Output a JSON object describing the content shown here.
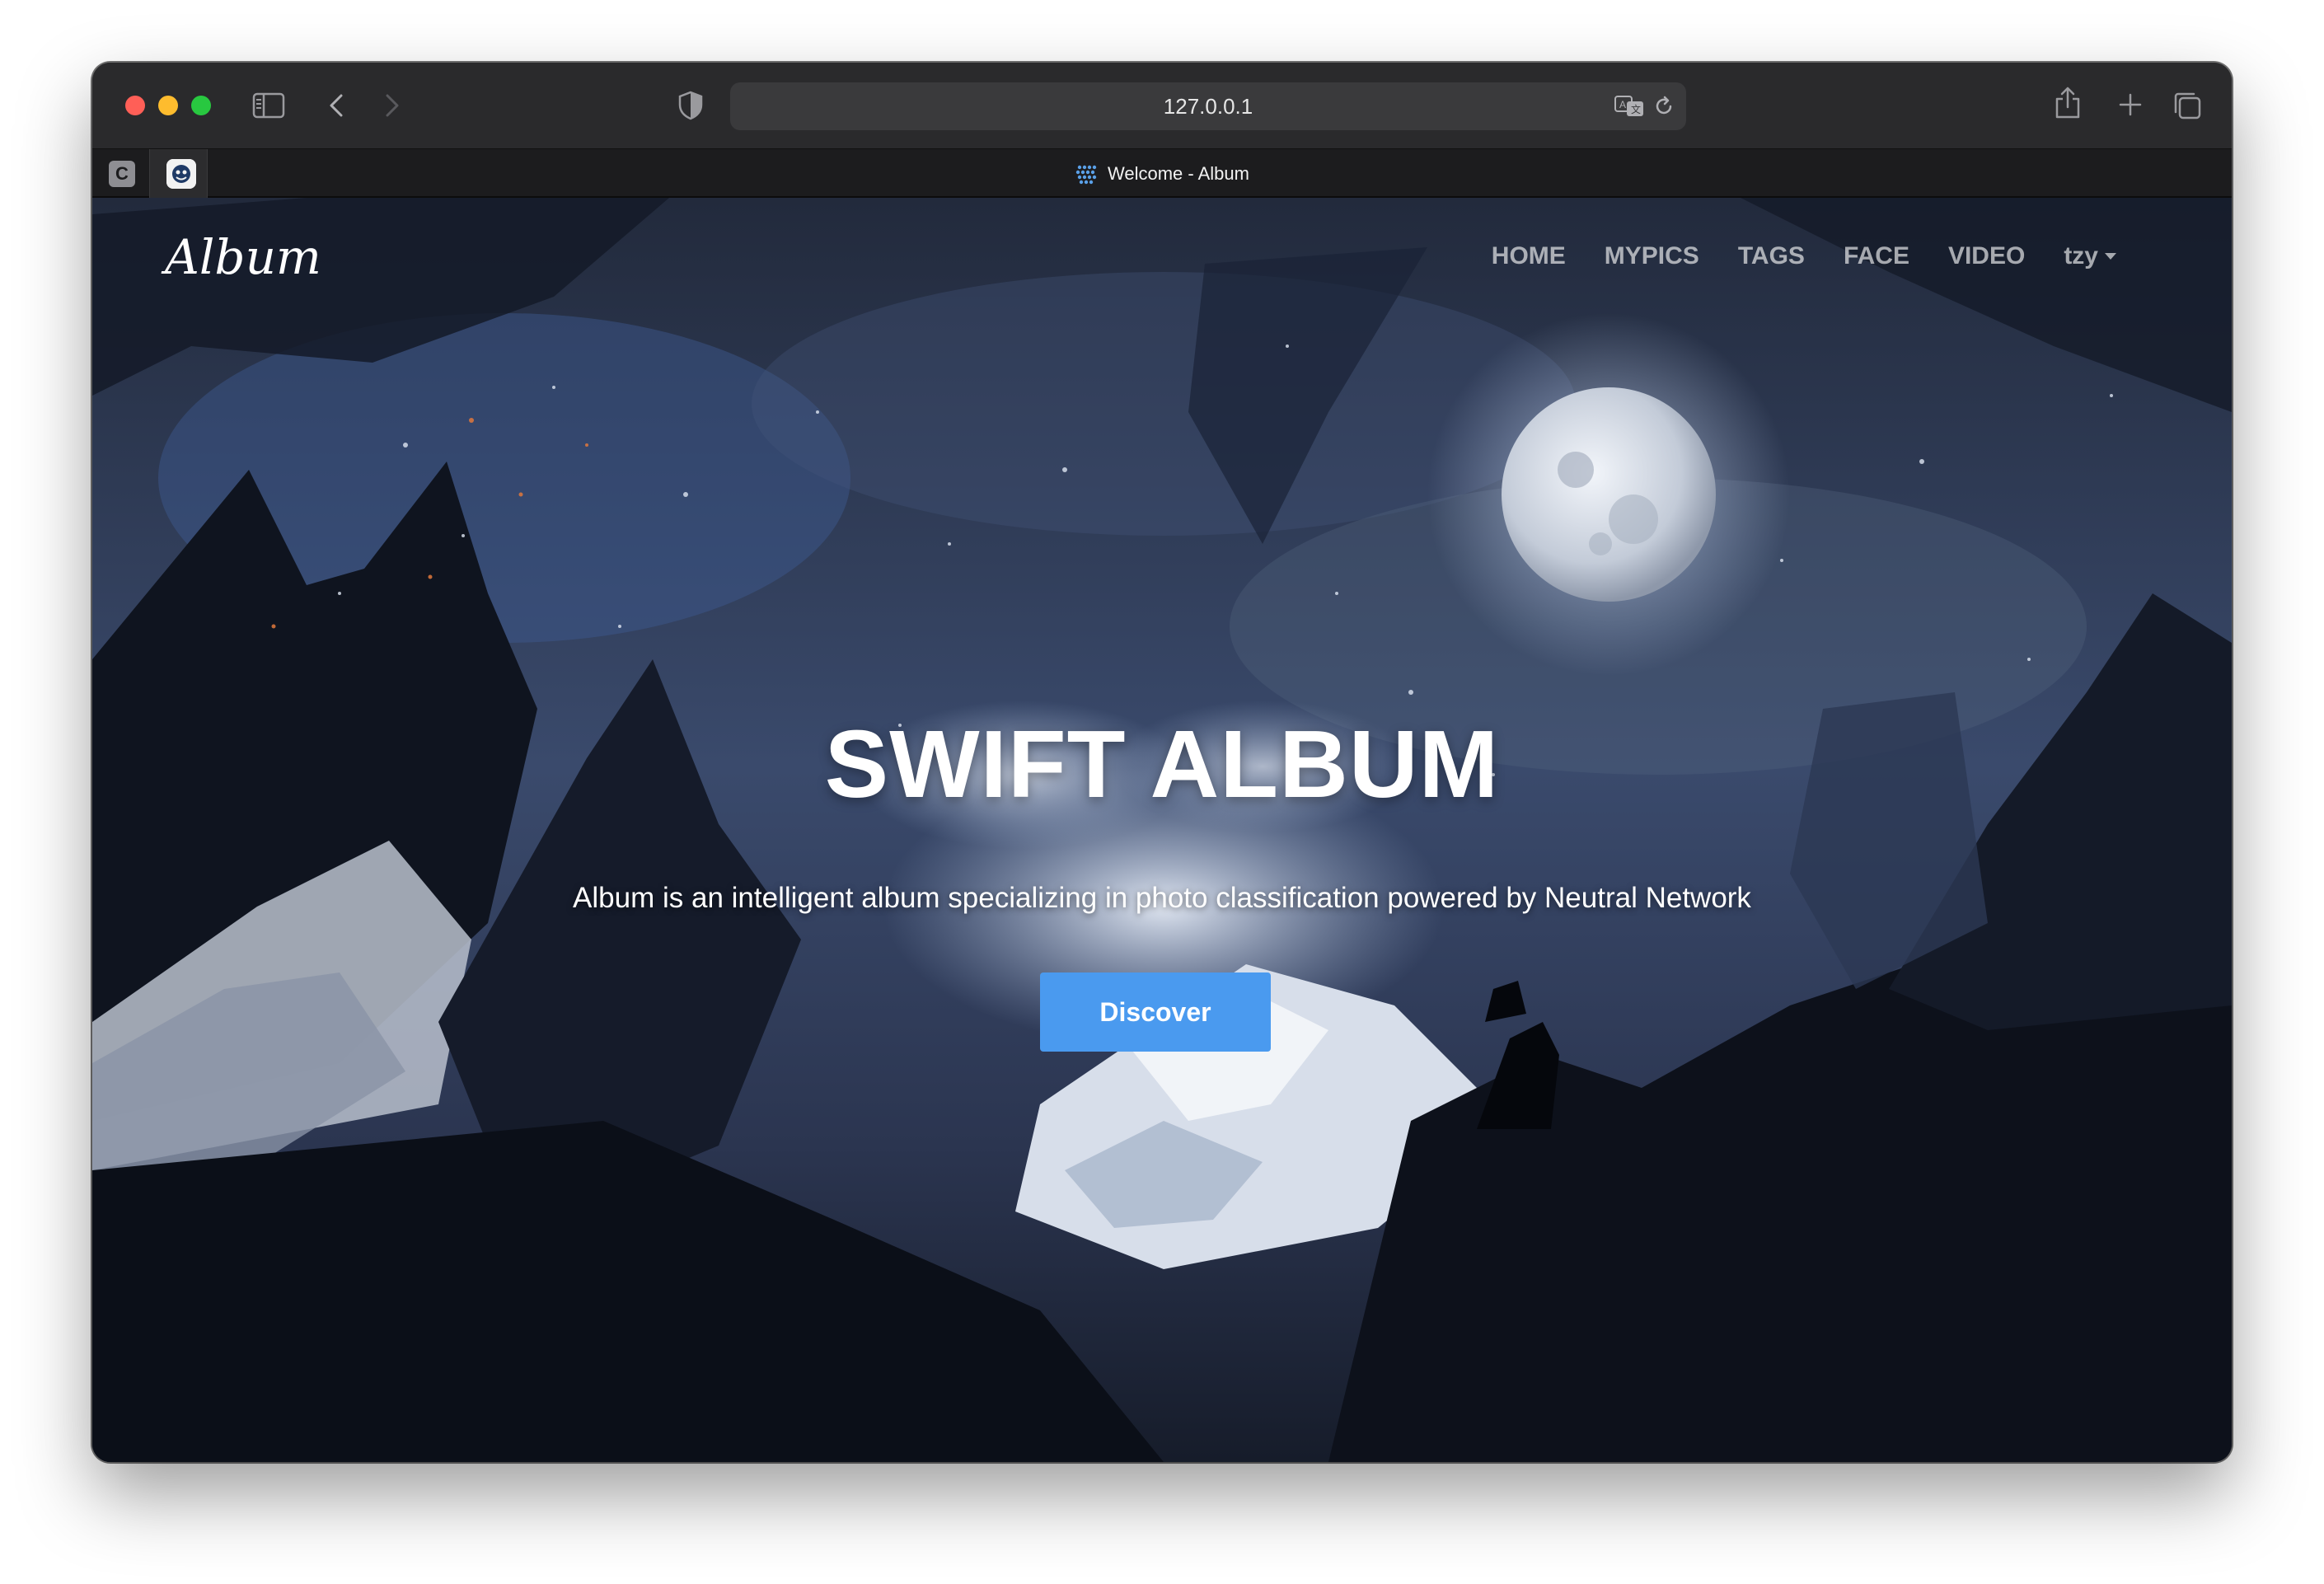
{
  "browser": {
    "address": "127.0.0.1",
    "tab_title": "Welcome - Album",
    "pinned_tabs": [
      {
        "label": "C"
      },
      {
        "icon": "app-logo-icon"
      }
    ],
    "icons": [
      "sidebar-icon",
      "back-icon",
      "forward-icon",
      "shield-icon",
      "translate-icon",
      "reload-icon",
      "share-icon",
      "new-tab-icon",
      "tab-overview-icon"
    ]
  },
  "site": {
    "brand": "Album",
    "nav": [
      {
        "label": "HOME"
      },
      {
        "label": "MYPICS"
      },
      {
        "label": "TAGS"
      },
      {
        "label": "FACE"
      },
      {
        "label": "VIDEO"
      }
    ],
    "user": "tzy",
    "hero": {
      "title": "SWIFT ALBUM",
      "subtitle": "Album is an intelligent album specializing in photo classification powered by Neutral Network",
      "button": "Discover"
    }
  },
  "colors": {
    "accent": "#4a9aef",
    "close": "#ff5f57",
    "minimize": "#febc2e",
    "maximize": "#28c840",
    "night_sky": "#1b2438"
  }
}
